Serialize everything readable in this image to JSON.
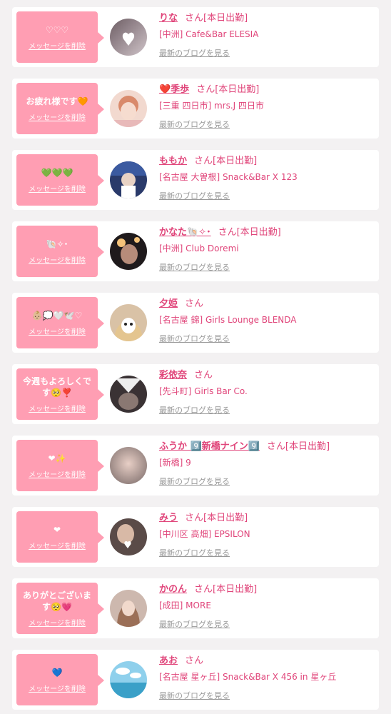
{
  "colors": {
    "accent": "#e0457a",
    "bubble": "#ff9eb3",
    "background": "#f3f1f2"
  },
  "delete_label": "メッセージを削除",
  "blog_label": "最新のブログを見る",
  "san_label": "さん",
  "items": [
    {
      "message": "♡♡♡",
      "name": "りな",
      "status": "[本日出勤]",
      "shop": "[中洲] Cafe&Bar ELESIA",
      "avatar": "avatar-1"
    },
    {
      "message": "お疲れ様です🧡",
      "name": "❤️季歩",
      "status": "[本日出勤]",
      "shop": "[三重 四日市] mrs.J 四日市",
      "avatar": "avatar-2"
    },
    {
      "message": "💚💚💚",
      "name": "ももか",
      "status": "[本日出勤]",
      "shop": "[名古屋 大曽根] Snack&Bar X 123",
      "avatar": "avatar-3"
    },
    {
      "message": "🐚✧･",
      "name": "かなた🐚✧･",
      "status": "[本日出勤]",
      "shop": "[中洲] Club Doremi",
      "avatar": "avatar-4"
    },
    {
      "message": "👶🏼💭🤍🕊️♡",
      "name": "夕姫",
      "status": "",
      "shop": "[名古屋 錦] Girls Lounge BLENDA",
      "avatar": "avatar-5"
    },
    {
      "message": "今週もよろしくです🥺❣️",
      "name": "彩依奈",
      "status": "",
      "shop": "[先斗町] Girls Bar Co.",
      "avatar": "avatar-6"
    },
    {
      "message": "❤✨",
      "name": "ふうか 9️⃣新橋ナイン9️⃣",
      "status": "[本日出勤]",
      "shop": "[新橋] 9",
      "avatar": "avatar-7"
    },
    {
      "message": "❤",
      "name": "みう",
      "status": "[本日出勤]",
      "shop": "[中川区 高畑] EPSILON",
      "avatar": "avatar-8"
    },
    {
      "message": "ありがとございます🥺💗",
      "name": "かのん",
      "status": "[本日出勤]",
      "shop": "[成田] MORE",
      "avatar": "avatar-9"
    },
    {
      "message": "💙",
      "name": "あお",
      "status": "",
      "shop": "[名古屋 星ヶ丘] Snack&Bar X 456 in 星ヶ丘",
      "avatar": "avatar-10"
    }
  ]
}
